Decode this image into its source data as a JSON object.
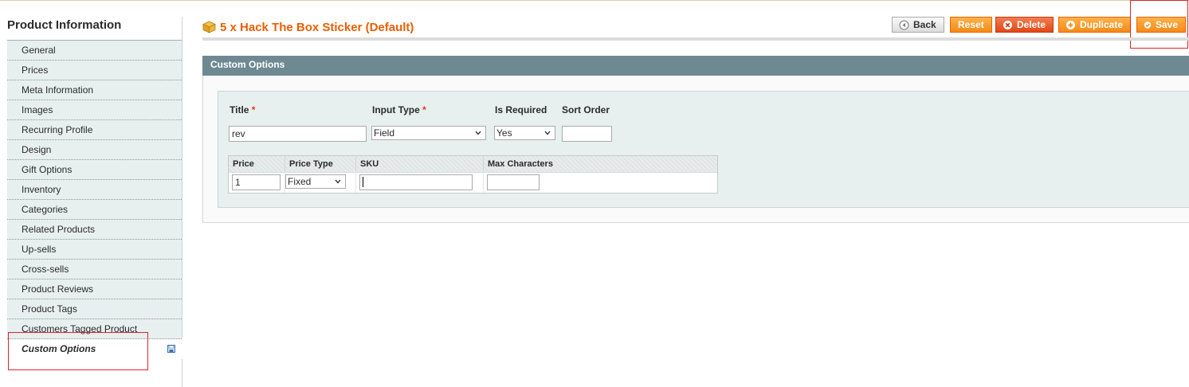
{
  "sidebar": {
    "title": "Product Information",
    "items": [
      {
        "label": "General"
      },
      {
        "label": "Prices"
      },
      {
        "label": "Meta Information"
      },
      {
        "label": "Images"
      },
      {
        "label": "Recurring Profile"
      },
      {
        "label": "Design"
      },
      {
        "label": "Gift Options"
      },
      {
        "label": "Inventory"
      },
      {
        "label": "Categories"
      },
      {
        "label": "Related Products"
      },
      {
        "label": "Up-sells"
      },
      {
        "label": "Cross-sells"
      },
      {
        "label": "Product Reviews"
      },
      {
        "label": "Product Tags"
      },
      {
        "label": "Customers Tagged Product"
      },
      {
        "label": "Custom Options",
        "active": true
      }
    ],
    "active_item_icon": "save-state-icon"
  },
  "header": {
    "title": "5 x Hack The Box Sticker (Default)",
    "product_icon": "box-icon"
  },
  "toolbar": {
    "back_label": "Back",
    "reset_label": "Reset",
    "delete_label": "Delete",
    "duplicate_label": "Duplicate",
    "save_label": "Save"
  },
  "custom_options": {
    "section_title": "Custom Options",
    "title_label": "Title",
    "input_type_label": "Input Type",
    "is_required_label": "Is Required",
    "sort_order_label": "Sort Order",
    "required_marker": "*",
    "title_value": "rev",
    "input_type_value": "Field",
    "is_required_value": "Yes",
    "sort_order_value": "",
    "price_table": {
      "headers": [
        "Price",
        "Price Type",
        "SKU",
        "Max Characters"
      ],
      "price_value": "1",
      "price_type_value": "Fixed",
      "sku_value": "",
      "max_characters_value": ""
    }
  },
  "colors": {
    "accent_orange": "#eb5e00",
    "button_orange": "#f58a16",
    "section_header": "#6f8992",
    "highlight_red": "#e0242b"
  }
}
